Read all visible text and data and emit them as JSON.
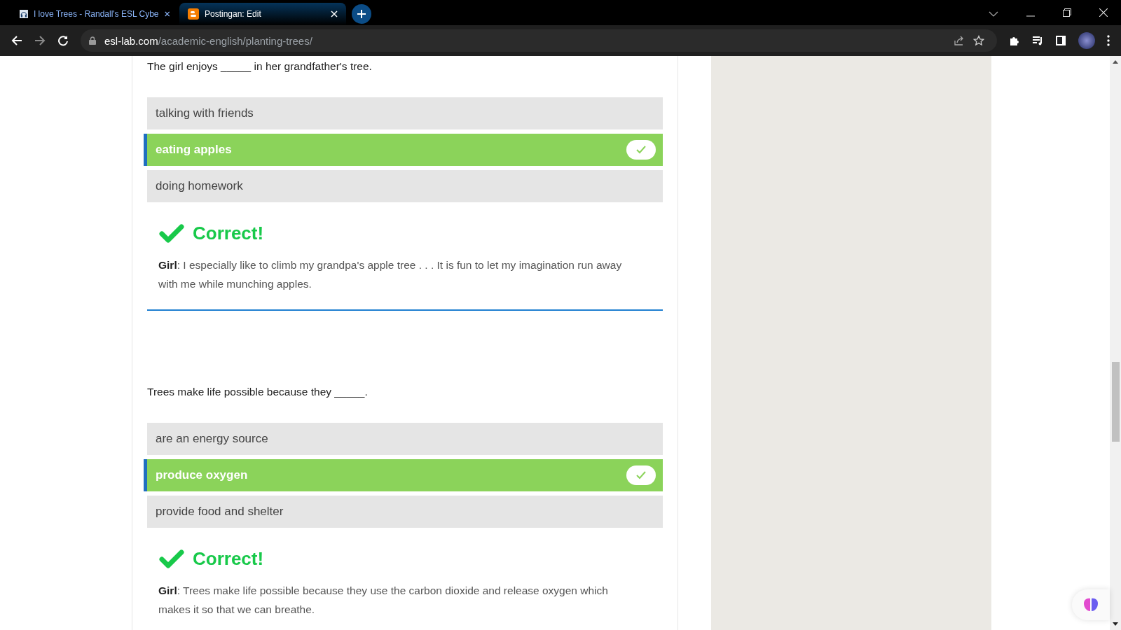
{
  "browser": {
    "tabs": [
      {
        "title": "I love Trees - Randall's ESL Cybe",
        "selected": false
      },
      {
        "title": "Postingan: Edit",
        "selected": true
      }
    ],
    "url_domain": "esl-lab.com",
    "url_path": "/academic-english/planting-trees/"
  },
  "questions": [
    {
      "prompt": "The girl enjoys _____ in her grandfather's tree.",
      "options": [
        {
          "text": "talking with friends",
          "selected": false
        },
        {
          "text": "eating apples",
          "selected": true
        },
        {
          "text": "doing homework",
          "selected": false
        }
      ],
      "verdict": "Correct!",
      "explanation": "**Girl**: I especially like to climb my grandpa's apple tree . . . It is fun to let my imagination run away with me while munching apples."
    },
    {
      "prompt": "Trees make life possible because they _____.",
      "options": [
        {
          "text": "are an energy source",
          "selected": false
        },
        {
          "text": "produce oxygen",
          "selected": true
        },
        {
          "text": "provide food and shelter",
          "selected": false
        }
      ],
      "verdict": "Correct!",
      "explanation": "**Girl**: Trees make life possible because they use the carbon dioxide and release oxygen which makes it so that we can breathe."
    }
  ]
}
